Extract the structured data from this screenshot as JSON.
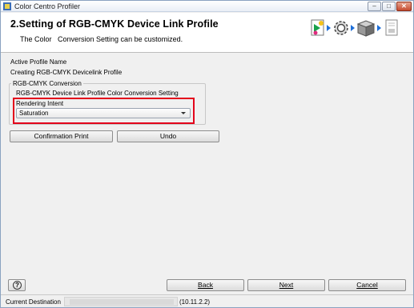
{
  "window": {
    "title": "Color Centro Profiler",
    "controls": {
      "minimize": "–",
      "maximize": "□",
      "close": "✕"
    }
  },
  "header": {
    "step_title": "2.Setting of RGB-CMYK Device Link Profile",
    "subtitle": "The Color   Conversion Setting can be customized.",
    "step_icons": [
      "document-color-icon",
      "gear-icon",
      "printer-box-icon",
      "document-icon"
    ]
  },
  "content": {
    "active_profile_label": "Active Profile Name",
    "active_profile_value": "Creating RGB-CMYK Devicelink Profile",
    "group_legend": "RGB-CMYK Conversion",
    "setting_label": "RGB-CMYK Device Link Profile Color Conversion Setting",
    "rendering_intent_label": "Rendering Intent",
    "rendering_intent_value": "Saturation"
  },
  "buttons": {
    "confirmation_print": "Confirmation Print",
    "undo": "Undo",
    "back": "Back",
    "next": "Next",
    "cancel": "Cancel"
  },
  "status": {
    "label": "Current Destination",
    "ip": "(10.11.2.2)"
  },
  "colors": {
    "highlight": "#e3001b",
    "step_arrow": "#1e6fd9"
  }
}
